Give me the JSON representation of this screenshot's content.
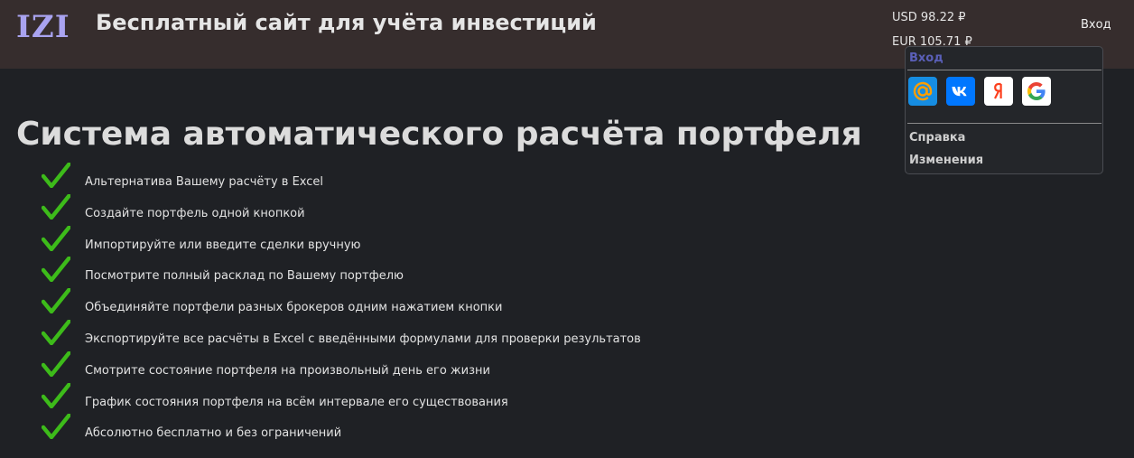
{
  "header": {
    "logo": "IZI",
    "title": "Бесплатный сайт для учёта инвестиций",
    "rates": {
      "usd": "USD 98.22 ₽",
      "eur": "EUR 105.71 ₽"
    },
    "login_label": "Вход"
  },
  "login_menu": {
    "title": "Вход",
    "providers": [
      {
        "name": "mail-ru",
        "icon": "at-icon",
        "color": "#168de2"
      },
      {
        "name": "vk",
        "icon": "vk-icon",
        "color": "#0077ff"
      },
      {
        "name": "yandex",
        "icon": "yandex-icon",
        "color": "#fc3f1d"
      },
      {
        "name": "google",
        "icon": "google-icon",
        "color": "#4285f4"
      }
    ],
    "items": [
      "Справка",
      "Изменения"
    ]
  },
  "main": {
    "title": "Система автоматического расчёта портфеля",
    "features": [
      "Альтернатива Вашему расчёту в Excel",
      "Создайте портфель одной кнопкой",
      "Импортируйте или введите сделки вручную",
      "Посмотрите полный расклад по Вашему портфелю",
      "Объединяйте портфели разных брокеров одним нажатием кнопки",
      "Экспортируйте все расчёты в Excel с введёнными формулами для проверки результатов",
      "Смотрите состояние портфеля на произвольный день его жизни",
      "График состояния портфеля на всём интервале его существования",
      "Абсолютно бесплатно и без ограничений"
    ]
  },
  "colors": {
    "header_bg": "#362d2d",
    "page_bg": "#1f2125",
    "logo": "#a9a3f0",
    "check": "#3dbb1a",
    "menu_title": "#5a5fb8"
  }
}
